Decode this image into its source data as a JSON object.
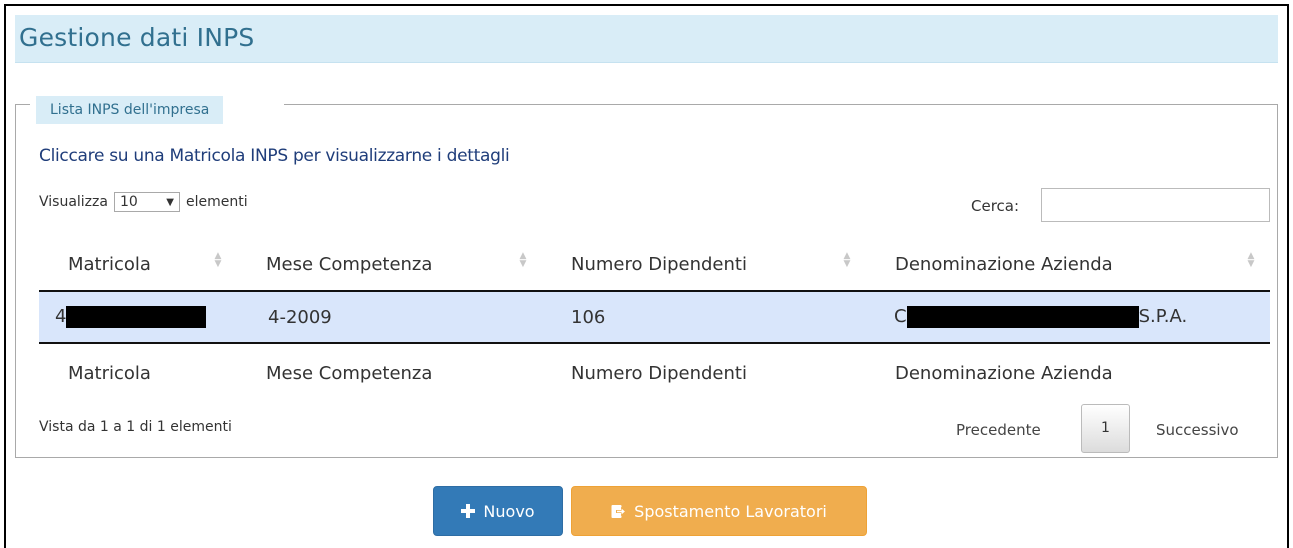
{
  "header": {
    "title": "Gestione dati INPS"
  },
  "panel": {
    "legend": "Lista INPS dell'impresa",
    "hint": "Cliccare su una Matricola INPS per visualizzarne i dettagli"
  },
  "length_control": {
    "prefix": "Visualizza",
    "selected": "10",
    "suffix": "elementi"
  },
  "search": {
    "label": "Cerca:",
    "value": ""
  },
  "table": {
    "columns": [
      "Matricola",
      "Mese Competenza",
      "Numero Dipendenti",
      "Denominazione Azienda"
    ],
    "rows": [
      {
        "matricola_prefix": "4",
        "mese": "4-2009",
        "dipendenti": "106",
        "denominazione_prefix": "C",
        "denominazione_suffix": "S.P.A."
      }
    ]
  },
  "info": "Vista da 1 a 1 di 1 elementi",
  "pagination": {
    "previous": "Precedente",
    "current": "1",
    "next": "Successivo"
  },
  "actions": {
    "new_label": "Nuovo",
    "move_label": "Spostamento Lavoratori"
  },
  "colors": {
    "header_bg": "#d9edf7",
    "title": "#31708f",
    "row_selected": "#d9e6fb",
    "primary": "#337ab7",
    "warning": "#f0ad4e"
  },
  "icons": {
    "sort": "sort-icon",
    "new": "plus-icon",
    "move": "share-icon"
  }
}
